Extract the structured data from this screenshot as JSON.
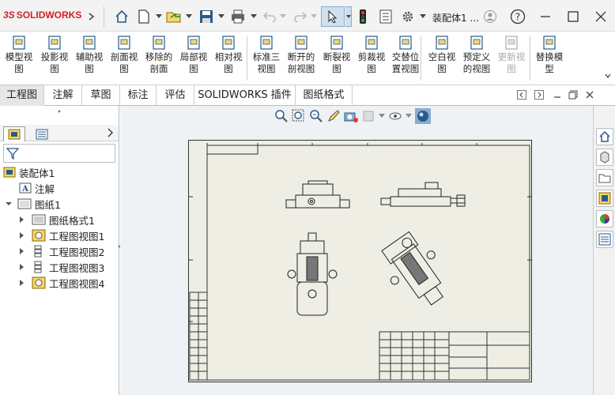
{
  "app": {
    "brand": "SOLIDWORKS",
    "brand_ds": "3S",
    "doc_title": "装配体1 ...",
    "help": "?"
  },
  "commands": [
    {
      "line1": "模型视",
      "line2": "图",
      "disabled": false
    },
    {
      "line1": "投影视",
      "line2": "图",
      "disabled": false
    },
    {
      "line1": "辅助视",
      "line2": "图",
      "disabled": false
    },
    {
      "line1": "剖面视",
      "line2": "图",
      "disabled": false
    },
    {
      "line1": "移除的",
      "line2": "剖面",
      "disabled": false
    },
    {
      "line1": "局部视",
      "line2": "图",
      "disabled": false
    },
    {
      "line1": "相对视",
      "line2": "图",
      "disabled": false
    },
    {
      "line1": "标准三",
      "line2": "视图",
      "disabled": false
    },
    {
      "line1": "断开的",
      "line2": "剖视图",
      "disabled": false
    },
    {
      "line1": "断裂视",
      "line2": "图",
      "disabled": false
    },
    {
      "line1": "剪裁视",
      "line2": "图",
      "disabled": false
    },
    {
      "line1": "交替位",
      "line2": "置视图",
      "disabled": false
    },
    {
      "line1": "空白视",
      "line2": "图",
      "disabled": false
    },
    {
      "line1": "预定义",
      "line2": "的视图",
      "disabled": false
    },
    {
      "line1": "更新视",
      "line2": "图",
      "disabled": true
    },
    {
      "line1": "替换模",
      "line2": "型",
      "disabled": false
    }
  ],
  "tabs": [
    "工程图",
    "注解",
    "草图",
    "标注",
    "评估",
    "SOLIDWORKS 插件",
    "图纸格式"
  ],
  "tree": {
    "root": "装配体1",
    "annotations": "注解",
    "sheet": "图纸1",
    "children": [
      "图纸格式1",
      "工程图视图1",
      "工程图视图2",
      "工程图视图3",
      "工程图视图4"
    ]
  },
  "colors": {
    "accent": "#d0202a",
    "sheet_bg": "#eeeee4",
    "canvas_bg": "#eef2f5"
  }
}
